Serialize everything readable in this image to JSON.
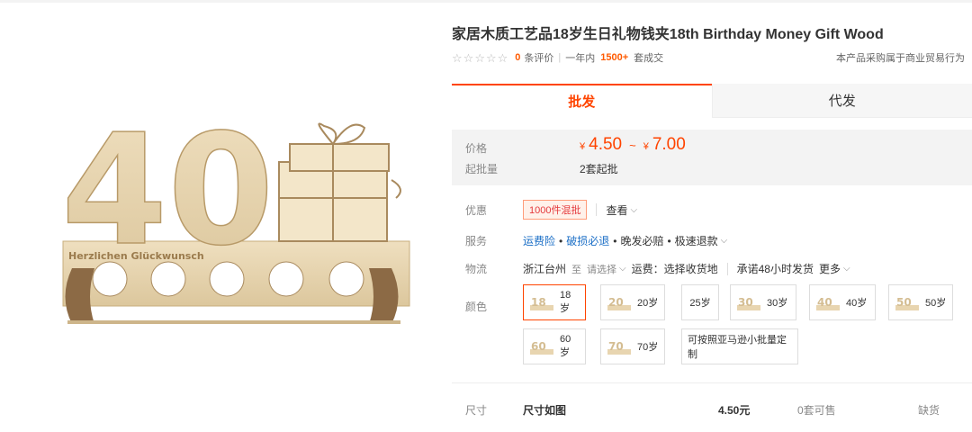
{
  "product": {
    "title": "家居木质工艺品18岁生日礼物钱夹18th Birthday Money Gift Wood",
    "image_alt_text": "Herzlichen Glückwunsch",
    "image_big_number": "40"
  },
  "rating": {
    "review_count": "0",
    "review_label": "条评价",
    "year_label": "一年内",
    "sold_count": "1500+",
    "sold_label": "套成交",
    "notice": "本产品采购属于商业贸易行为"
  },
  "tabs": [
    {
      "label": "批发",
      "active": true
    },
    {
      "label": "代发",
      "active": false
    }
  ],
  "price": {
    "label": "价格",
    "currency": "¥",
    "min": "4.50",
    "separator": "~",
    "max": "7.00",
    "moq_label": "起批量",
    "moq_value": "2套起批"
  },
  "promo": {
    "label": "优惠",
    "badge": "1000件混批",
    "view": "查看"
  },
  "service": {
    "label": "服务",
    "items": [
      "运费险",
      "破损必退",
      "晚发必赔",
      "极速退款"
    ]
  },
  "logistics": {
    "label": "物流",
    "origin": "浙江台州",
    "to": "至",
    "select": "请选择",
    "freight": "运费：选择收货地",
    "promise": "承诺48小时发货",
    "more": "更多"
  },
  "colors": {
    "label": "颜色",
    "items": [
      {
        "label": "18岁",
        "thumb": "18",
        "selected": true
      },
      {
        "label": "20岁",
        "thumb": "20",
        "selected": false
      },
      {
        "label": "25岁",
        "thumb": "",
        "selected": false
      },
      {
        "label": "30岁",
        "thumb": "30",
        "selected": false
      },
      {
        "label": "40岁",
        "thumb": "40",
        "selected": false
      },
      {
        "label": "50岁",
        "thumb": "50",
        "selected": false
      },
      {
        "label": "60岁",
        "thumb": "60",
        "selected": false
      },
      {
        "label": "70岁",
        "thumb": "70",
        "selected": false
      },
      {
        "label": "可按照亚马逊小批量定制",
        "thumb": "",
        "selected": false
      }
    ]
  },
  "sku": {
    "label": "尺寸",
    "name": "尺寸如图",
    "price": "4.50元",
    "stock": "0套可售",
    "status": "缺货"
  },
  "theme": {
    "accent": "#ff4400",
    "link": "#1a6ec6",
    "wood": "#e8d5b0"
  }
}
